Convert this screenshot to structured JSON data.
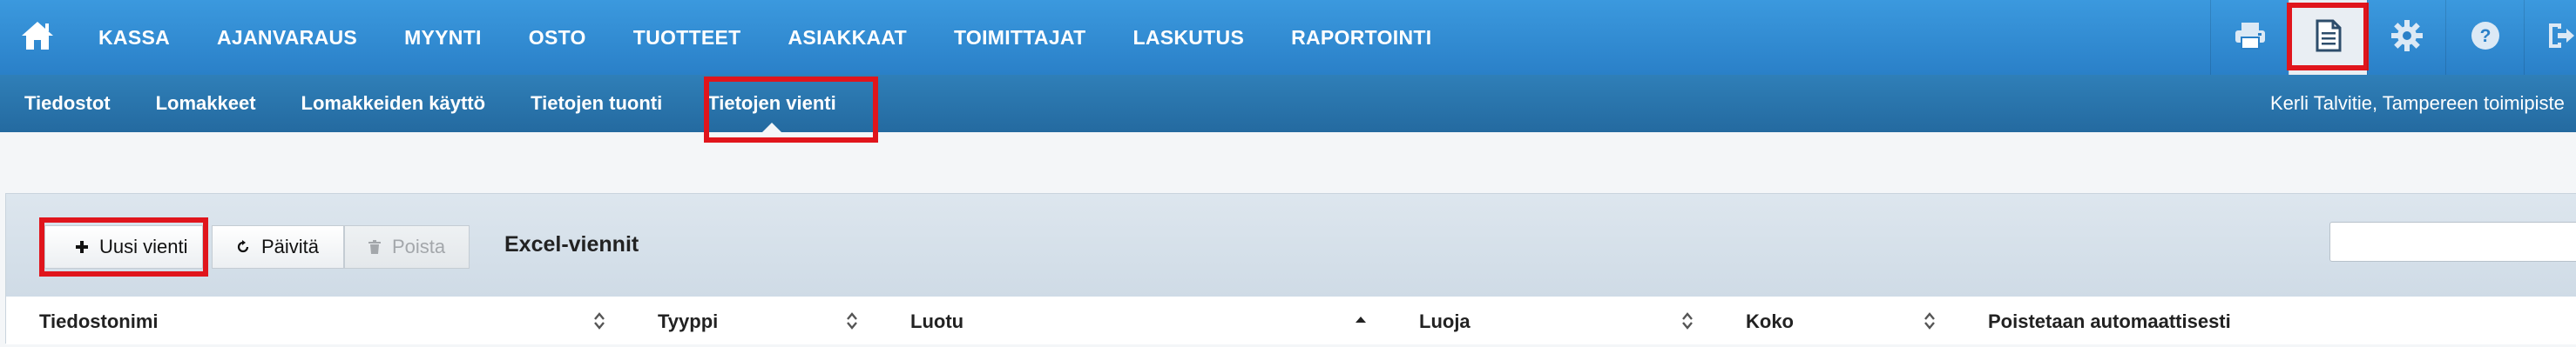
{
  "main_nav": [
    "KASSA",
    "AJANVARAUS",
    "MYYNTI",
    "OSTO",
    "TUOTTEET",
    "ASIAKKAAT",
    "TOIMITTAJAT",
    "LASKUTUS",
    "RAPORTOINTI"
  ],
  "tools": [
    "printer-icon",
    "document-icon",
    "gear-icon",
    "help-icon",
    "logout-icon"
  ],
  "sub_nav": [
    "Tiedostot",
    "Lomakkeet",
    "Lomakkeiden käyttö",
    "Tietojen tuonti",
    "Tietojen vienti"
  ],
  "sub_nav_active": "Tietojen vienti",
  "user_info": "Kerli Talvitie, Tampereen toimipiste",
  "toolbar": {
    "new_label": "Uusi vienti",
    "refresh_label": "Päivitä",
    "delete_label": "Poista"
  },
  "panel_title": "Excel-viennit",
  "search": {
    "value": "",
    "placeholder": ""
  },
  "table": {
    "columns": [
      "Tiedostonimi",
      "Tyyppi",
      "Luotu",
      "Luoja",
      "Koko",
      "Poistetaan automaattisesti"
    ],
    "sorted_column": "Luotu",
    "sort_direction": "ascending"
  },
  "colors": {
    "topbar": "#2f8bd3",
    "subbar": "#2a72aa",
    "highlight": "#e0151c",
    "panel_header": "#d6e0ea"
  }
}
